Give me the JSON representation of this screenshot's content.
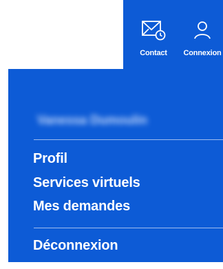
{
  "header": {
    "contact": {
      "label": "Contact",
      "icon": "mail-clock-icon"
    },
    "connexion": {
      "label": "Connexion",
      "icon": "user-icon"
    }
  },
  "panel": {
    "username": "Vanessa Dumoulin",
    "menu": {
      "profil": "Profil",
      "services": "Services virtuels",
      "demandes": "Mes demandes",
      "logout": "Déconnexion"
    }
  },
  "colors": {
    "brand_blue": "#0d5bd6",
    "text": "#ffffff"
  }
}
